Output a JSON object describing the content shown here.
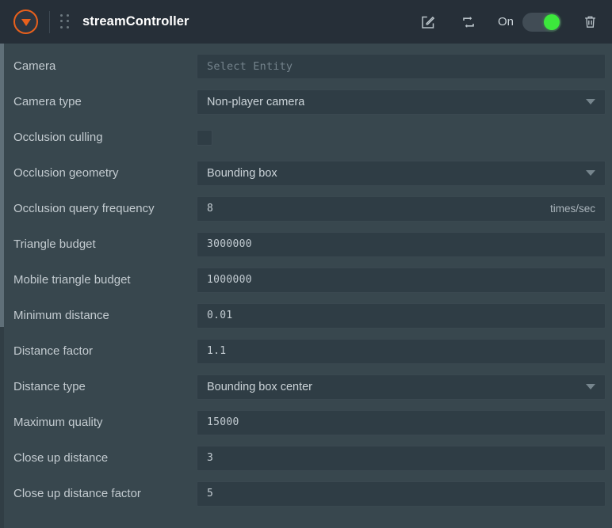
{
  "header": {
    "logo_icon": "orange-circle-triangle-logo",
    "drag_handle_icon": "drag-dots-icon",
    "title": "streamController",
    "edit_icon": "edit-pencil-square-icon",
    "loop_icon": "loop-repeat-icon",
    "toggle_label": "On",
    "toggle_state": "on",
    "delete_icon": "trash-icon",
    "background_color": "#262f38",
    "accent_color": "#e8601c",
    "toggle_on_color": "#3ce83c"
  },
  "panel": {
    "background_color": "#38474e",
    "field_background_color": "#2f3d45",
    "label_color": "#c3cbd0"
  },
  "scrollbar": {
    "orientation": "vertical",
    "position": "left"
  },
  "rows": [
    {
      "label": "Camera",
      "control": "entity-picker",
      "value": "",
      "placeholder": "Select Entity",
      "name": "camera"
    },
    {
      "label": "Camera type",
      "control": "dropdown",
      "value": "Non-player camera",
      "name": "camera-type"
    },
    {
      "label": "Occlusion culling",
      "control": "checkbox",
      "value": "unchecked",
      "name": "occlusion-culling"
    },
    {
      "label": "Occlusion geometry",
      "control": "dropdown",
      "value": "Bounding box",
      "name": "occlusion-geometry"
    },
    {
      "label": "Occlusion query frequency",
      "control": "number",
      "value": "8",
      "suffix": "times/sec",
      "name": "occlusion-query-frequency"
    },
    {
      "label": "Triangle budget",
      "control": "number",
      "value": "3000000",
      "name": "triangle-budget"
    },
    {
      "label": "Mobile triangle budget",
      "control": "number",
      "value": "1000000",
      "name": "mobile-triangle-budget"
    },
    {
      "label": "Minimum distance",
      "control": "number",
      "value": "0.01",
      "name": "minimum-distance"
    },
    {
      "label": "Distance factor",
      "control": "number",
      "value": "1.1",
      "name": "distance-factor"
    },
    {
      "label": "Distance type",
      "control": "dropdown",
      "value": "Bounding box center",
      "name": "distance-type"
    },
    {
      "label": "Maximum quality",
      "control": "number",
      "value": "15000",
      "name": "maximum-quality"
    },
    {
      "label": "Close up distance",
      "control": "number",
      "value": "3",
      "name": "close-up-distance"
    },
    {
      "label": "Close up distance factor",
      "control": "number",
      "value": "5",
      "name": "close-up-distance-factor"
    }
  ]
}
